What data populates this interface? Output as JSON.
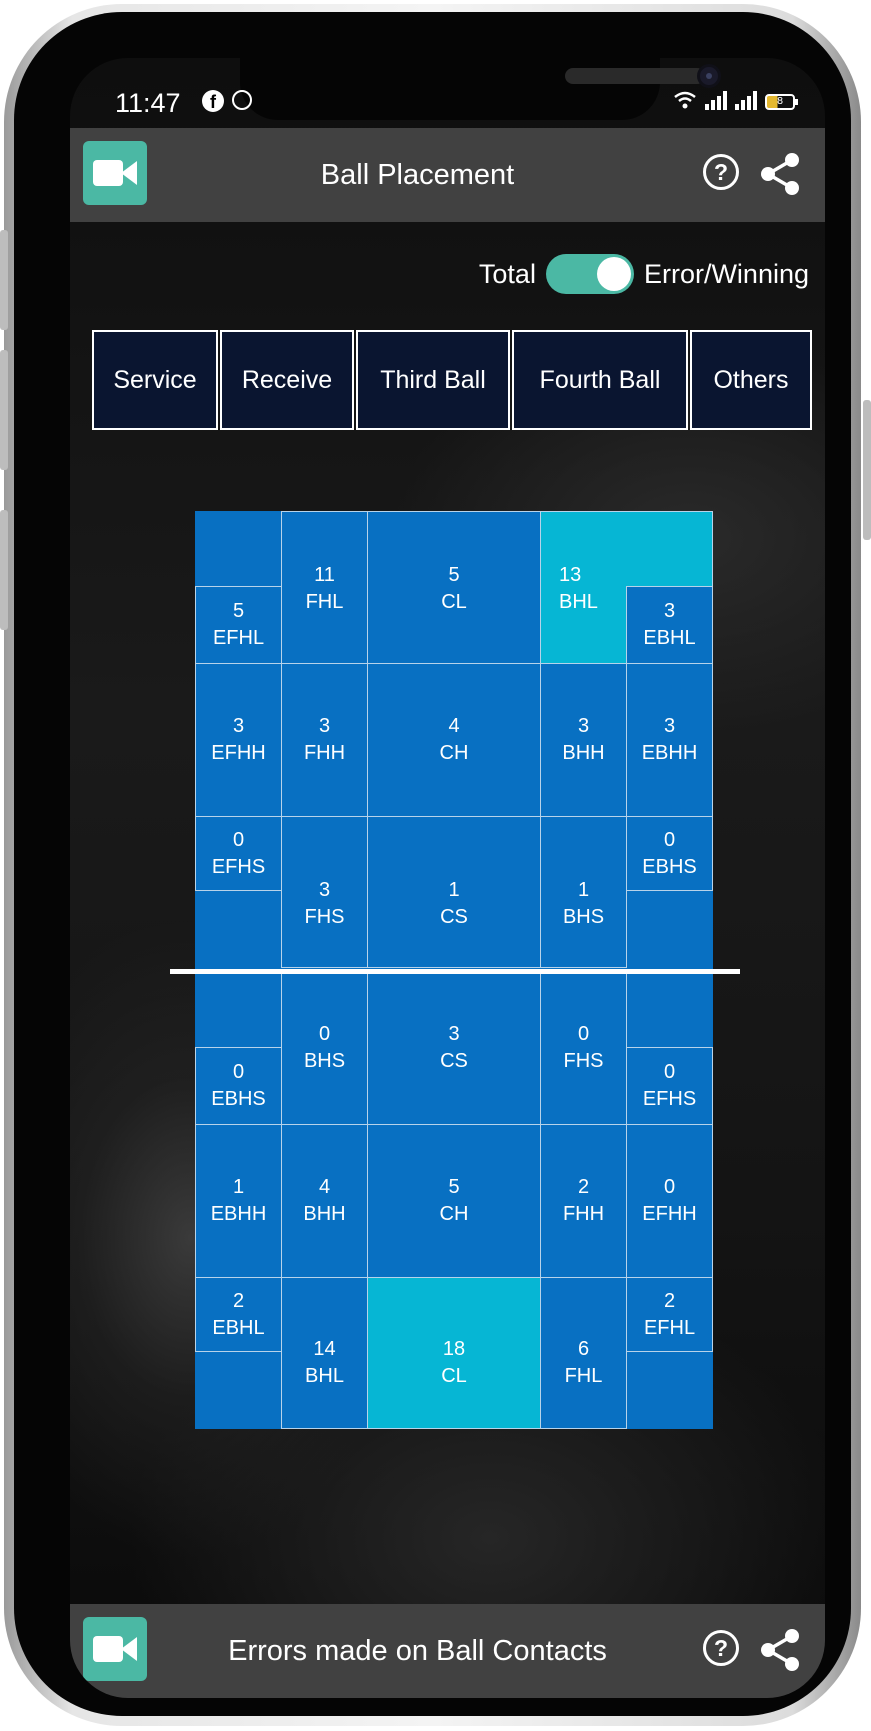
{
  "status_bar": {
    "time": "11:47",
    "battery": "8"
  },
  "header": {
    "title": "Ball Placement"
  },
  "toggle": {
    "left_label": "Total",
    "right_label": "Error/Winning",
    "state": "on"
  },
  "tabs": [
    "Service",
    "Receive",
    "Third Ball",
    "Fourth Ball",
    "Others"
  ],
  "court": {
    "highlight_color": "#06b6d4",
    "base_color": "#0870c2",
    "top_half": [
      {
        "value": "11",
        "label": "FHL"
      },
      {
        "value": "5",
        "label": "EFHL"
      },
      {
        "value": "5",
        "label": "CL"
      },
      {
        "value": "13",
        "label": "BHL"
      },
      {
        "value": "3",
        "label": "EBHL"
      },
      {
        "value": "3",
        "label": "EFHH"
      },
      {
        "value": "3",
        "label": "FHH"
      },
      {
        "value": "4",
        "label": "CH"
      },
      {
        "value": "3",
        "label": "BHH"
      },
      {
        "value": "3",
        "label": "EBHH"
      },
      {
        "value": "0",
        "label": "EFHS"
      },
      {
        "value": "3",
        "label": "FHS"
      },
      {
        "value": "1",
        "label": "CS"
      },
      {
        "value": "1",
        "label": "BHS"
      },
      {
        "value": "0",
        "label": "EBHS"
      }
    ],
    "bottom_half": [
      {
        "value": "0",
        "label": "BHS"
      },
      {
        "value": "0",
        "label": "EBHS"
      },
      {
        "value": "3",
        "label": "CS"
      },
      {
        "value": "0",
        "label": "FHS"
      },
      {
        "value": "0",
        "label": "EFHS"
      },
      {
        "value": "1",
        "label": "EBHH"
      },
      {
        "value": "4",
        "label": "BHH"
      },
      {
        "value": "5",
        "label": "CH"
      },
      {
        "value": "2",
        "label": "FHH"
      },
      {
        "value": "0",
        "label": "EFHH"
      },
      {
        "value": "2",
        "label": "EBHL"
      },
      {
        "value": "14",
        "label": "BHL"
      },
      {
        "value": "18",
        "label": "CL"
      },
      {
        "value": "6",
        "label": "FHL"
      },
      {
        "value": "2",
        "label": "EFHL"
      }
    ]
  },
  "footer": {
    "title": "Errors made on Ball Contacts"
  },
  "icons": {
    "camera": "video-camera-icon",
    "help": "help-circle-icon",
    "share": "share-icon"
  }
}
